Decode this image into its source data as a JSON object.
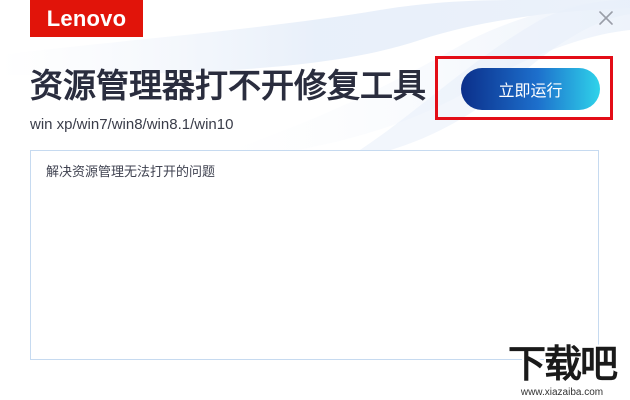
{
  "brand": {
    "logo_text": "Lenovo",
    "logo_color": "#e1140a"
  },
  "window": {
    "close_icon": "close-icon"
  },
  "header": {
    "title": "资源管理器打不开修复工具",
    "subtitle": "win xp/win7/win8/win8.1/win10"
  },
  "actions": {
    "run_label": "立即运行",
    "run_gradient": [
      "#0b2f8a",
      "#1d6fcc",
      "#2fd3ea"
    ],
    "highlight_color": "#e30d17"
  },
  "description": {
    "text": "解决资源管理无法打开的问题"
  },
  "watermark": {
    "main": "下载吧",
    "sub": "www.xiazaiba.com"
  }
}
